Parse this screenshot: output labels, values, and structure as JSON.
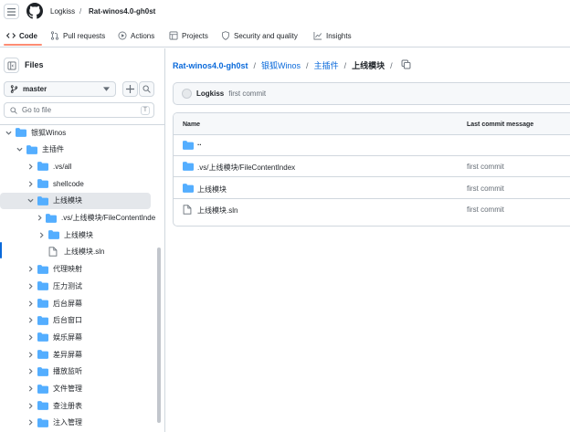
{
  "header": {
    "owner": "Logkiss",
    "separator": "/",
    "repo": "Rat-winos4.0-gh0st"
  },
  "tabs": [
    {
      "label": "Code",
      "icon": "code-icon",
      "selected": true
    },
    {
      "label": "Pull requests",
      "icon": "pull-request-icon",
      "selected": false
    },
    {
      "label": "Actions",
      "icon": "play-icon",
      "selected": false
    },
    {
      "label": "Projects",
      "icon": "table-icon",
      "selected": false
    },
    {
      "label": "Security and quality",
      "icon": "shield-icon",
      "selected": false
    },
    {
      "label": "Insights",
      "icon": "graph-icon",
      "selected": false
    }
  ],
  "sidebar": {
    "title": "Files",
    "branch": "master",
    "goto_placeholder": "Go to file",
    "goto_shortcut": "T",
    "tree": [
      {
        "label": "银狐Winos",
        "depth": 0,
        "type": "folder",
        "expanded": true
      },
      {
        "label": "主插件",
        "depth": 1,
        "type": "folder",
        "expanded": true
      },
      {
        "label": ".vs/all",
        "depth": 2,
        "type": "folder",
        "expanded": false
      },
      {
        "label": "shellcode",
        "depth": 2,
        "type": "folder",
        "expanded": false
      },
      {
        "label": "上线模块",
        "depth": 2,
        "type": "folder",
        "expanded": true,
        "selected": true
      },
      {
        "label": ".vs/上线模块/FileContentIndex",
        "depth": 3,
        "type": "folder",
        "expanded": false
      },
      {
        "label": "上线模块",
        "depth": 3,
        "type": "folder",
        "expanded": false
      },
      {
        "label": "上线模块.sln",
        "depth": 3,
        "type": "file"
      },
      {
        "label": "代理映射",
        "depth": 2,
        "type": "folder",
        "expanded": false
      },
      {
        "label": "压力测试",
        "depth": 2,
        "type": "folder",
        "expanded": false
      },
      {
        "label": "后台屏幕",
        "depth": 2,
        "type": "folder",
        "expanded": false
      },
      {
        "label": "后台窗口",
        "depth": 2,
        "type": "folder",
        "expanded": false
      },
      {
        "label": "娱乐屏幕",
        "depth": 2,
        "type": "folder",
        "expanded": false
      },
      {
        "label": "差异屏幕",
        "depth": 2,
        "type": "folder",
        "expanded": false
      },
      {
        "label": "播放监听",
        "depth": 2,
        "type": "folder",
        "expanded": false
      },
      {
        "label": "文件管理",
        "depth": 2,
        "type": "folder",
        "expanded": false
      },
      {
        "label": "查注册表",
        "depth": 2,
        "type": "folder",
        "expanded": false
      },
      {
        "label": "注入管理",
        "depth": 2,
        "type": "folder",
        "expanded": false
      }
    ]
  },
  "main": {
    "breadcrumb": [
      {
        "label": "Rat-winos4.0-gh0st",
        "kind": "repo"
      },
      {
        "label": "银狐Winos",
        "kind": "link"
      },
      {
        "label": "主插件",
        "kind": "link"
      },
      {
        "label": "上线模块",
        "kind": "current"
      }
    ],
    "breadcrumb_sep": "/",
    "commit": {
      "author": "Logkiss",
      "message": "first commit"
    },
    "table": {
      "col_name": "Name",
      "col_message": "Last commit message",
      "rows": [
        {
          "name": "..",
          "type": "parent",
          "message": ""
        },
        {
          "name": ".vs/上线模块/FileContentIndex",
          "type": "folder",
          "message": "first commit"
        },
        {
          "name": "上线模块",
          "type": "folder",
          "message": "first commit"
        },
        {
          "name": "上线模块.sln",
          "type": "file",
          "message": "first commit"
        }
      ]
    }
  },
  "colors": {
    "accent": "#0969da",
    "folder": "#54aeff",
    "tab_underline": "#fd8c73",
    "border": "#d0d7de"
  }
}
